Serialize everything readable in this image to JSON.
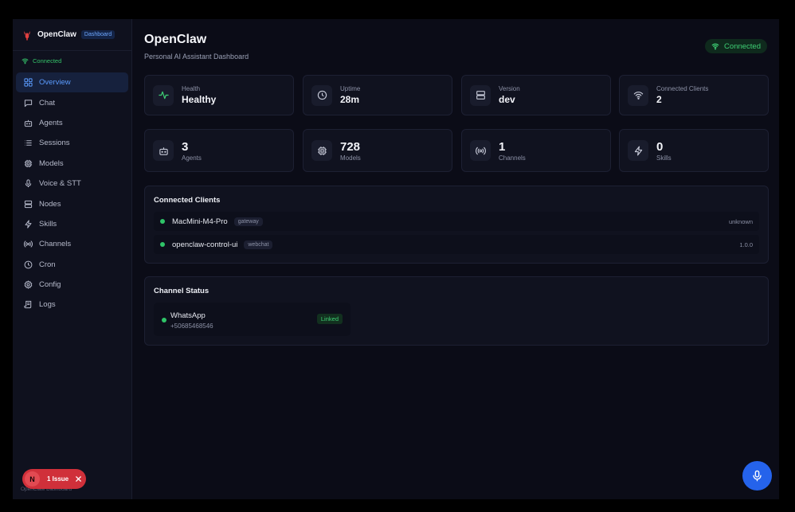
{
  "brand": {
    "name": "OpenClaw",
    "badge": "Dashboard"
  },
  "sidebar": {
    "connection": "Connected",
    "items": [
      {
        "label": "Overview",
        "icon": "grid-icon"
      },
      {
        "label": "Chat",
        "icon": "message-icon"
      },
      {
        "label": "Agents",
        "icon": "bot-icon"
      },
      {
        "label": "Sessions",
        "icon": "list-icon"
      },
      {
        "label": "Models",
        "icon": "cpu-icon"
      },
      {
        "label": "Voice & STT",
        "icon": "mic-icon"
      },
      {
        "label": "Nodes",
        "icon": "server-icon"
      },
      {
        "label": "Skills",
        "icon": "zap-icon"
      },
      {
        "label": "Channels",
        "icon": "radio-icon"
      },
      {
        "label": "Cron",
        "icon": "clock-icon"
      },
      {
        "label": "Config",
        "icon": "gear-icon"
      },
      {
        "label": "Logs",
        "icon": "scroll-icon"
      }
    ],
    "active_index": 0,
    "footer": "OpenClaw Dashboard"
  },
  "header": {
    "title": "OpenClaw",
    "subtitle": "Personal AI Assistant Dashboard",
    "status": "Connected"
  },
  "stats_top": [
    {
      "label": "Health",
      "value": "Healthy",
      "icon": "activity-icon"
    },
    {
      "label": "Uptime",
      "value": "28m",
      "icon": "clock-icon"
    },
    {
      "label": "Version",
      "value": "dev",
      "icon": "server-icon"
    },
    {
      "label": "Connected Clients",
      "value": "2",
      "icon": "wifi-icon"
    }
  ],
  "stats_bottom": [
    {
      "value": "3",
      "label": "Agents",
      "icon": "bot-icon"
    },
    {
      "value": "728",
      "label": "Models",
      "icon": "cpu-icon"
    },
    {
      "value": "1",
      "label": "Channels",
      "icon": "radio-icon"
    },
    {
      "value": "0",
      "label": "Skills",
      "icon": "zap-icon"
    }
  ],
  "clients": {
    "title": "Connected Clients",
    "rows": [
      {
        "name": "MacMini-M4-Pro",
        "tag": "gateway",
        "meta": "unknown"
      },
      {
        "name": "openclaw-control-ui",
        "tag": "webchat",
        "meta": "1.0.0"
      }
    ]
  },
  "channels": {
    "title": "Channel Status",
    "items": [
      {
        "name": "WhatsApp",
        "phone": "+50685468546",
        "status": "Linked"
      }
    ]
  },
  "issue": {
    "avatar": "N",
    "text": "1 Issue"
  },
  "colors": {
    "accent": "#5b9cff",
    "success": "#3ecf74",
    "danger": "#d0303a",
    "primary_button": "#2563eb"
  }
}
